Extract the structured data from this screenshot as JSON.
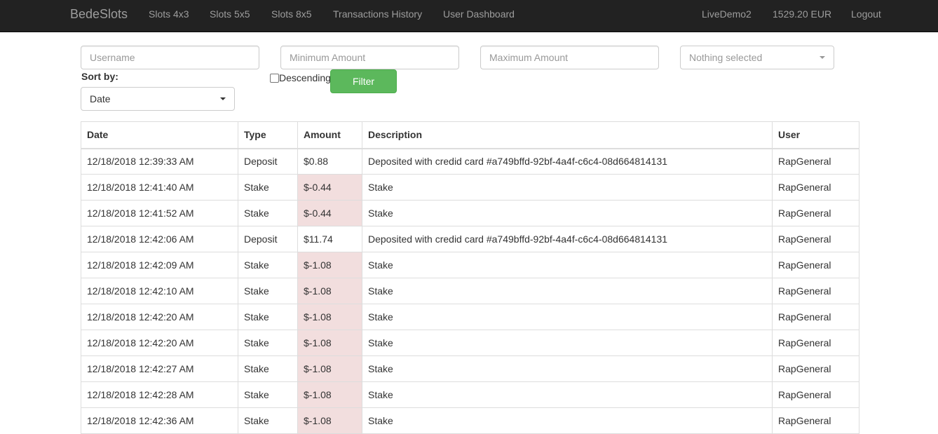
{
  "navbar": {
    "brand": "BedeSlots",
    "links": [
      "Slots 4x3",
      "Slots 5x5",
      "Slots 8x5",
      "Transactions History",
      "User Dashboard"
    ],
    "username": "LiveDemo2",
    "balance": "1529.20 EUR",
    "logout": "Logout"
  },
  "filters": {
    "username_placeholder": "Username",
    "min_amount_placeholder": "Minimum Amount",
    "max_amount_placeholder": "Maximum Amount",
    "type_select_value": "Nothing selected",
    "sort_by_label": "Sort by:",
    "sort_by_value": "Date",
    "descending_label": "Descending",
    "descending_checked": false,
    "filter_button": "Filter"
  },
  "colors": {
    "navbar_bg": "#222222",
    "navbar_link": "#9d9d9d",
    "filter_button": "#5cb85c",
    "negative_amount_bg": "#f2dede"
  },
  "table": {
    "headers": [
      "Date",
      "Type",
      "Amount",
      "Description",
      "User"
    ],
    "rows": [
      {
        "date": "12/18/2018 12:39:33 AM",
        "type": "Deposit",
        "amount": "$0.88",
        "description": "Deposited with credid card #a749bffd-92bf-4a4f-c6c4-08d664814131",
        "user": "RapGeneral",
        "negative": false
      },
      {
        "date": "12/18/2018 12:41:40 AM",
        "type": "Stake",
        "amount": "$-0.44",
        "description": "Stake",
        "user": "RapGeneral",
        "negative": true
      },
      {
        "date": "12/18/2018 12:41:52 AM",
        "type": "Stake",
        "amount": "$-0.44",
        "description": "Stake",
        "user": "RapGeneral",
        "negative": true
      },
      {
        "date": "12/18/2018 12:42:06 AM",
        "type": "Deposit",
        "amount": "$11.74",
        "description": "Deposited with credid card #a749bffd-92bf-4a4f-c6c4-08d664814131",
        "user": "RapGeneral",
        "negative": false
      },
      {
        "date": "12/18/2018 12:42:09 AM",
        "type": "Stake",
        "amount": "$-1.08",
        "description": "Stake",
        "user": "RapGeneral",
        "negative": true
      },
      {
        "date": "12/18/2018 12:42:10 AM",
        "type": "Stake",
        "amount": "$-1.08",
        "description": "Stake",
        "user": "RapGeneral",
        "negative": true
      },
      {
        "date": "12/18/2018 12:42:20 AM",
        "type": "Stake",
        "amount": "$-1.08",
        "description": "Stake",
        "user": "RapGeneral",
        "negative": true
      },
      {
        "date": "12/18/2018 12:42:20 AM",
        "type": "Stake",
        "amount": "$-1.08",
        "description": "Stake",
        "user": "RapGeneral",
        "negative": true
      },
      {
        "date": "12/18/2018 12:42:27 AM",
        "type": "Stake",
        "amount": "$-1.08",
        "description": "Stake",
        "user": "RapGeneral",
        "negative": true
      },
      {
        "date": "12/18/2018 12:42:28 AM",
        "type": "Stake",
        "amount": "$-1.08",
        "description": "Stake",
        "user": "RapGeneral",
        "negative": true
      },
      {
        "date": "12/18/2018 12:42:36 AM",
        "type": "Stake",
        "amount": "$-1.08",
        "description": "Stake",
        "user": "RapGeneral",
        "negative": true
      }
    ]
  }
}
